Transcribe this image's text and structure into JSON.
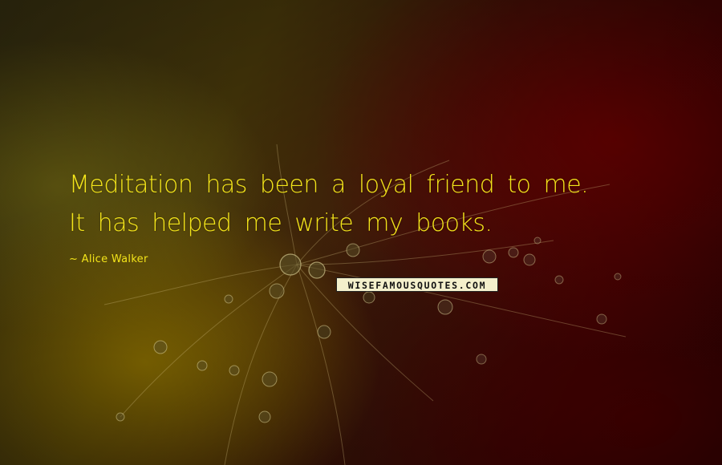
{
  "quote": {
    "line1": "Meditation has been a loyal friend to me.",
    "line2": "It has helped me write my books."
  },
  "author": "~ Alice Walker",
  "watermark": "WISEFAMOUSQUOTES.COM",
  "colors": {
    "text": "#f3e41a",
    "background_left": "#4a3a0a",
    "background_right": "#3c0303"
  }
}
